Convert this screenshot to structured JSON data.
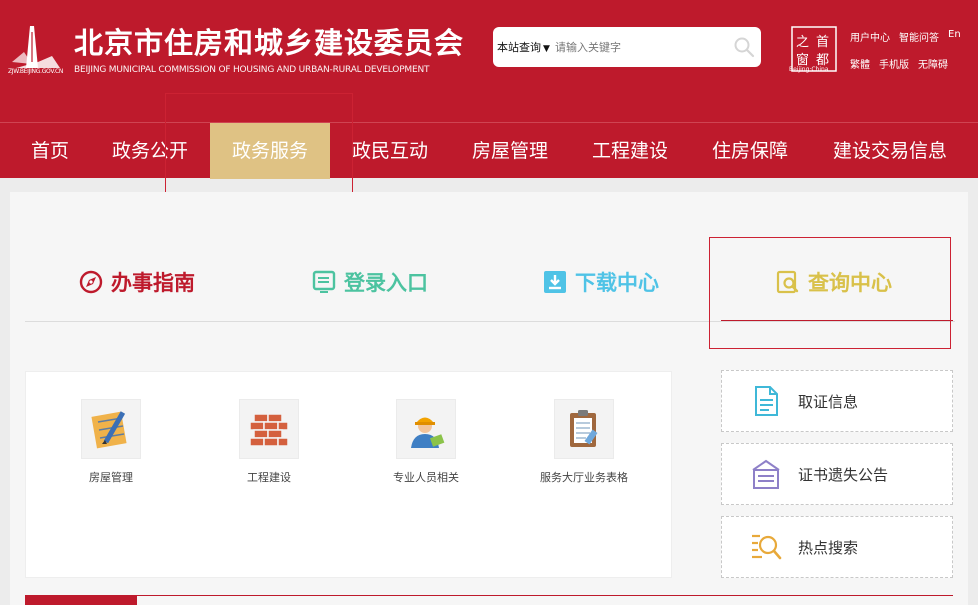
{
  "header": {
    "logo_url_text": "ZJW.BEIJING.GOV.CN",
    "title": "北京市住房和城乡建设委员会",
    "subtitle": "BEIJING MUNICIPAL COMMISSION OF HOUSING AND URBAN-RURAL DEVELOPMENT",
    "search": {
      "scope": "本站查询",
      "placeholder": "请输入关键字"
    },
    "seal_chars": [
      "首",
      "都",
      "之",
      "窗"
    ],
    "seal_caption": "Beijing·China",
    "links_row1": [
      "用户中心",
      "智能问答",
      "En"
    ],
    "links_row2": [
      "繁體",
      "手机版",
      "无障碍"
    ]
  },
  "nav": {
    "items": [
      "首页",
      "政务公开",
      "政务服务",
      "政民互动",
      "房屋管理",
      "工程建设",
      "住房保障",
      "建设交易信息"
    ],
    "active_index": 2
  },
  "tabs": [
    {
      "label": "办事指南",
      "color": "#be1a2c",
      "icon": "compass-icon"
    },
    {
      "label": "登录入口",
      "color": "#4cc3a0",
      "icon": "login-screen-icon"
    },
    {
      "label": "下载中心",
      "color": "#4fc3e6",
      "icon": "download-icon"
    },
    {
      "label": "查询中心",
      "color": "#d9c14a",
      "icon": "query-document-icon"
    }
  ],
  "services": [
    {
      "label": "房屋管理",
      "icon": "blueprint-pencil-icon"
    },
    {
      "label": "工程建设",
      "icon": "brick-wall-icon"
    },
    {
      "label": "专业人员相关",
      "icon": "worker-icon"
    },
    {
      "label": "服务大厅业务表格",
      "icon": "clipboard-icon"
    }
  ],
  "side_links": [
    {
      "label": "取证信息",
      "icon": "document-icon"
    },
    {
      "label": "证书遗失公告",
      "icon": "announcement-icon"
    },
    {
      "label": "热点搜索",
      "icon": "hot-search-icon"
    }
  ],
  "colors": {
    "brand_red": "#be1a2c",
    "nav_active": "#dfc284"
  }
}
